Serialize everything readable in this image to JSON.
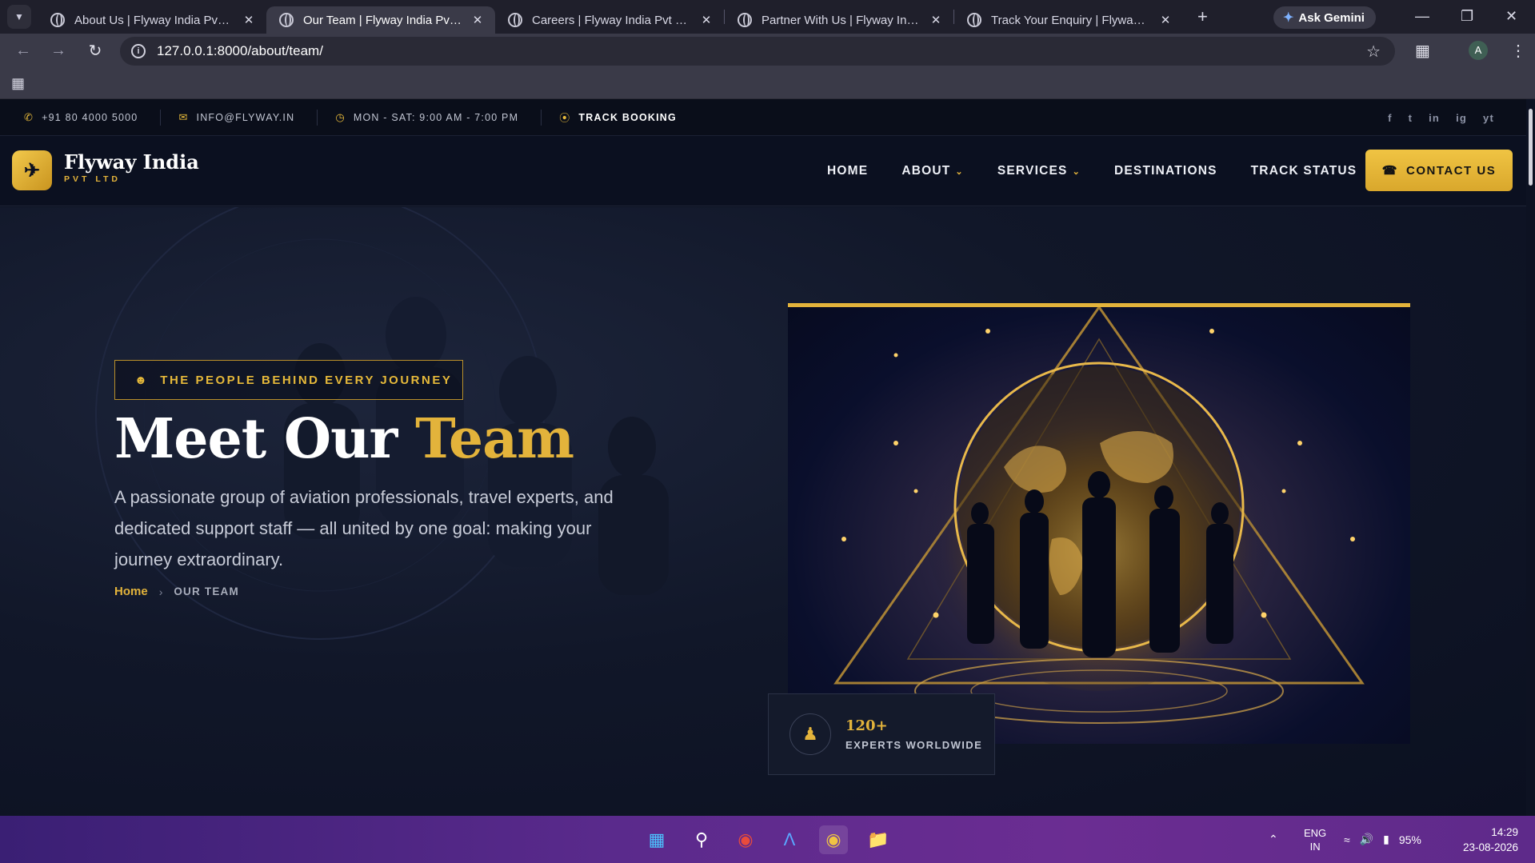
{
  "browser": {
    "tabs": [
      {
        "title": "About Us | Flyway India Pvt Ltd",
        "active": false
      },
      {
        "title": "Our Team | Flyway India Pvt Ltd",
        "active": true
      },
      {
        "title": "Careers | Flyway India Pvt Ltd",
        "active": false
      },
      {
        "title": "Partner With Us | Flyway India",
        "active": false
      },
      {
        "title": "Track Your Enquiry | Flyway India",
        "active": false
      }
    ],
    "gemini_label": "Ask Gemini",
    "url": "127.0.0.1:8000/about/team/",
    "profile_initial": "A"
  },
  "topbar": {
    "phone": "+91 80 4000 5000",
    "email": "INFO@FLYWAY.IN",
    "hours": "MON - SAT: 9:00 AM - 7:00 PM",
    "track": "TRACK BOOKING",
    "socials": [
      "f",
      "t",
      "in",
      "ig",
      "yt"
    ]
  },
  "header": {
    "brand": "Flyway India",
    "brand_sub": "PVT LTD",
    "nav": [
      {
        "label": "HOME",
        "dropdown": false
      },
      {
        "label": "ABOUT",
        "dropdown": true
      },
      {
        "label": "SERVICES",
        "dropdown": true
      },
      {
        "label": "DESTINATIONS",
        "dropdown": false
      },
      {
        "label": "TRACK STATUS",
        "dropdown": false
      }
    ],
    "contact_label": "CONTACT US"
  },
  "hero": {
    "badge": "THE PEOPLE BEHIND EVERY JOURNEY",
    "title_main": "Meet Our ",
    "title_accent": "Team",
    "description": "A passionate group of aviation professionals, travel experts, and dedicated support staff — all united by one goal: making your journey extraordinary.",
    "breadcrumb_home": "Home",
    "breadcrumb_current": "OUR TEAM",
    "stat_value": "120+",
    "stat_label": "EXPERTS WORLDWIDE"
  },
  "taskbar": {
    "lang_top": "ENG",
    "lang_bottom": "IN",
    "battery": "95%",
    "time": "14:29",
    "date": "23-08-2026"
  },
  "colors": {
    "accent": "#e3b33b",
    "page_bg": "#0d1222"
  }
}
